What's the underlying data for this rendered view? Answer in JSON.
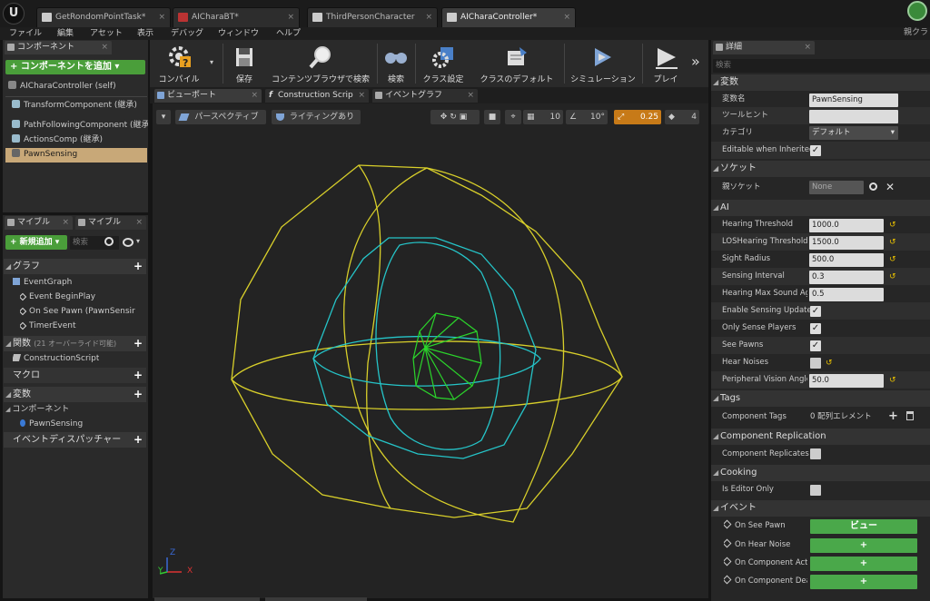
{
  "doc_tabs": [
    {
      "label": "GetRondomPointTask*",
      "icon": "blueprint-icon"
    },
    {
      "label": "AICharaBT*",
      "icon": "behavior-tree-icon"
    },
    {
      "label": "ThirdPersonCharacter",
      "icon": "blueprint-icon"
    },
    {
      "label": "AICharaController*",
      "icon": "blueprint-icon"
    }
  ],
  "user_label": "親クラ",
  "menu": [
    "ファイル",
    "編集",
    "アセット",
    "表示",
    "デバッグ",
    "ウィンドウ",
    "ヘルプ"
  ],
  "components_panel": {
    "tab": "コンポーネント",
    "add_button": "+ コンポーネントを追加 ▾",
    "self": "AICharaController (self)",
    "items": [
      "TransformComponent (継承)",
      "PathFollowingComponent (継承)",
      "ActionsComp (継承)",
      "PawnSensing"
    ]
  },
  "mybp_panel": {
    "tabs": [
      "マイブル",
      "マイブル"
    ],
    "new_button": "+ 新規追加 ▾",
    "search_placeholder": "検索",
    "graph_section": "グラフ",
    "graph_items": [
      "EventGraph",
      "Event BeginPlay",
      "On See Pawn (PawnSensir",
      "TimerEvent"
    ],
    "functions_section": "関数",
    "functions_note": "(21 オーバーライド可能)",
    "functions_items": [
      "ConstructionScript"
    ],
    "macro_section": "マクロ",
    "variables_section": "変数",
    "variables_sub": "コンポーネント",
    "variables_items": [
      "PawnSensing"
    ],
    "dispatchers_section": "イベントディスパッチャー"
  },
  "toolbar": [
    {
      "label": "コンパイル",
      "icon": "compile-icon"
    },
    {
      "label": "保存",
      "icon": "save-icon"
    },
    {
      "label": "コンテンツブラウザで検索",
      "icon": "browse-icon"
    },
    {
      "label": "検索",
      "icon": "find-icon"
    },
    {
      "label": "クラス設定",
      "icon": "class-settings-icon"
    },
    {
      "label": "クラスのデフォルト",
      "icon": "class-defaults-icon"
    },
    {
      "label": "シミュレーション",
      "icon": "simulation-icon"
    },
    {
      "label": "プレイ",
      "icon": "play-icon"
    }
  ],
  "editor_tabs": [
    "ビューポート",
    "Construction Scrip",
    "イベントグラフ"
  ],
  "viewport": {
    "perspective": "パースペクティブ",
    "lighting": "ライティングあり",
    "grid_snap": "10",
    "rot_snap": "10°",
    "scale_snap": "0.25",
    "cam_speed": "4",
    "axis_x": "X",
    "axis_y": "Y",
    "axis_z": "Z"
  },
  "details": {
    "tab": "詳細",
    "search_placeholder": "検索",
    "variable_section": "変数",
    "var_name_label": "変数名",
    "var_name_value": "PawnSensing",
    "tooltip_label": "ツールヒント",
    "tooltip_value": "",
    "category_label": "カテゴリ",
    "category_value": "デフォルト",
    "editable_label": "Editable when Inherited",
    "socket_section": "ソケット",
    "parent_socket_label": "親ソケット",
    "parent_socket_value": "None",
    "ai_section": "AI",
    "ai_props": [
      {
        "label": "Hearing Threshold",
        "value": "1000.0"
      },
      {
        "label": "LOSHearing Threshold",
        "value": "1500.0"
      },
      {
        "label": "Sight Radius",
        "value": "500.0"
      },
      {
        "label": "Sensing Interval",
        "value": "0.3"
      },
      {
        "label": "Hearing Max Sound Age",
        "value": "0.5"
      }
    ],
    "ai_checks": [
      {
        "label": "Enable Sensing Updates",
        "checked": true
      },
      {
        "label": "Only Sense Players",
        "checked": true
      },
      {
        "label": "See Pawns",
        "checked": true
      },
      {
        "label": "Hear Noises",
        "checked": false
      }
    ],
    "peripheral_label": "Peripheral Vision Angle",
    "peripheral_value": "50.0",
    "tags_section": "Tags",
    "component_tags_label": "Component Tags",
    "component_tags_value": "0 配列エレメント",
    "replication_section": "Component Replication",
    "replicates_label": "Component Replicates",
    "cooking_section": "Cooking",
    "editor_only_label": "Is Editor Only",
    "events_section": "イベント",
    "events": [
      {
        "label": "On See Pawn",
        "button": "ビュー"
      },
      {
        "label": "On Hear Noise",
        "button": "+"
      },
      {
        "label": "On Component Act",
        "button": "+"
      },
      {
        "label": "On Component Dea",
        "button": "+"
      }
    ]
  },
  "colors": {
    "sight_yellow": "#d8cf2a",
    "hearing_cyan": "#25c4c8",
    "vision_green": "#2bd62b",
    "accent_green": "#4a9e3a",
    "selection": "#c8a878"
  }
}
